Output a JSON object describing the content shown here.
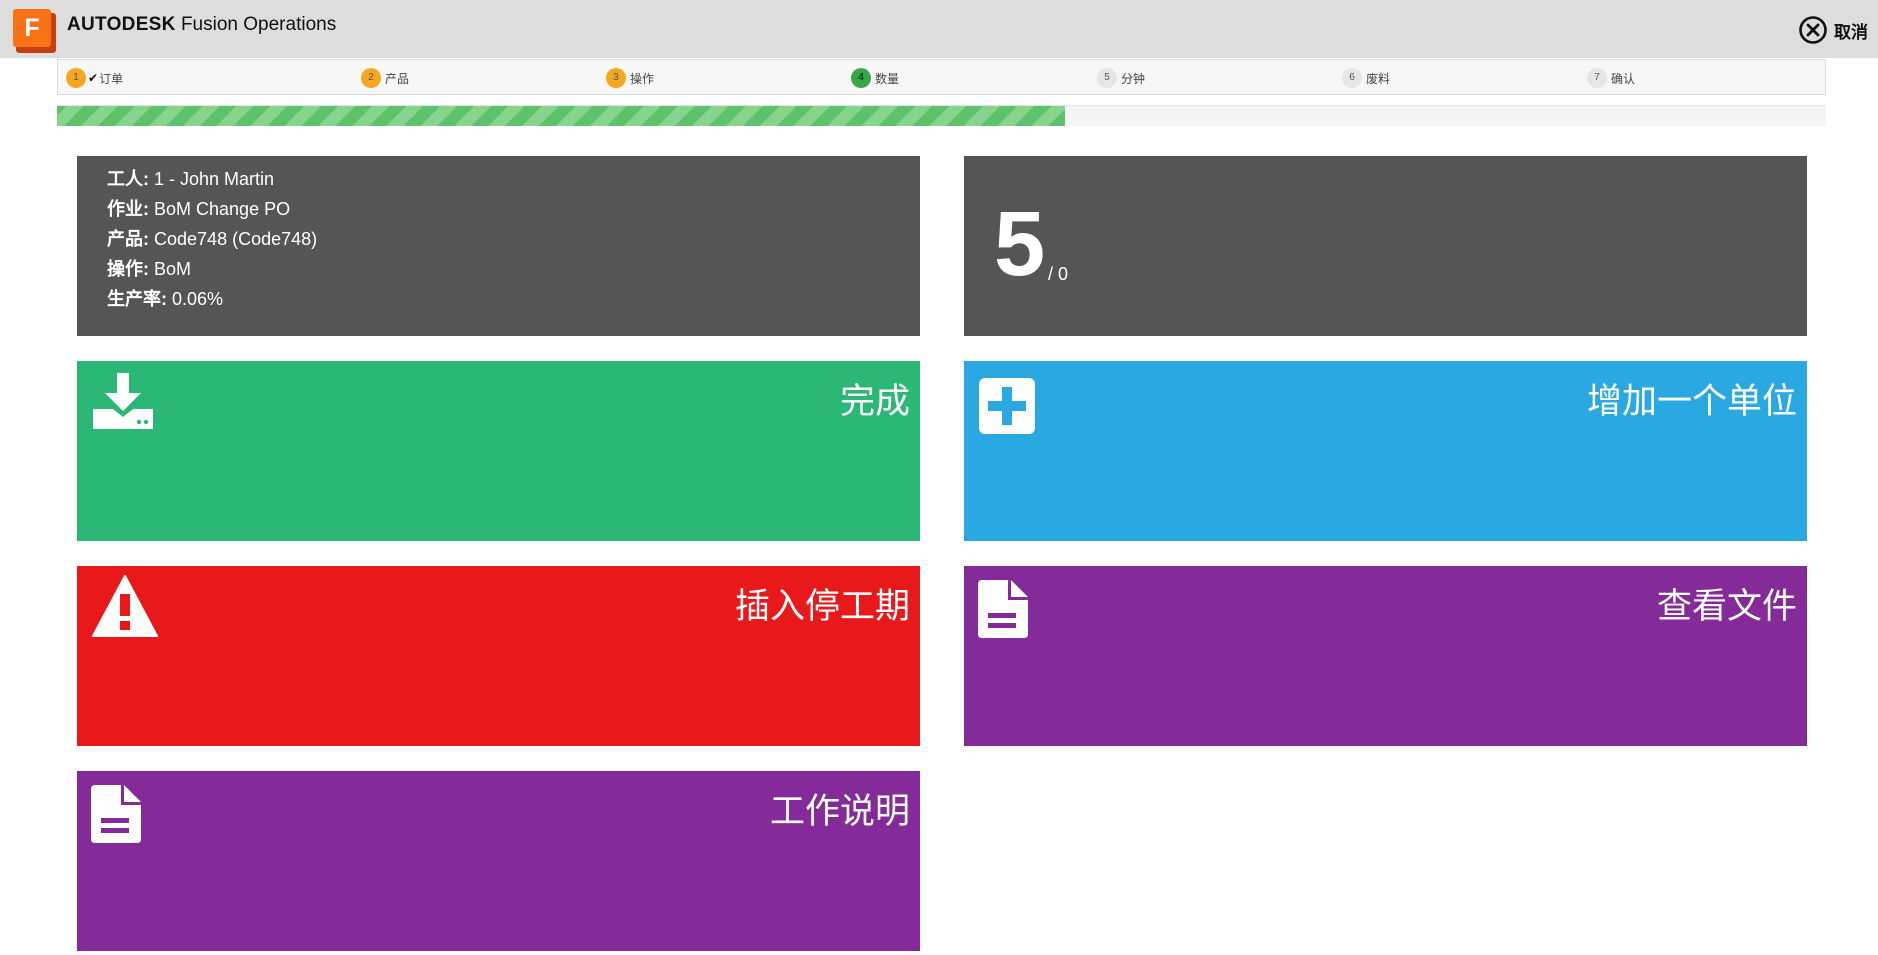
{
  "header": {
    "brand_bold": "AUTODESK",
    "brand_rest": "Fusion Operations",
    "logo_letter": "F",
    "cancel_label": "取消"
  },
  "steps": [
    {
      "num": "1",
      "label": "订单",
      "checked": true,
      "color": "#f5a623"
    },
    {
      "num": "2",
      "label": "产品",
      "color": "#f5a623"
    },
    {
      "num": "3",
      "label": "操作",
      "color": "#f5a623"
    },
    {
      "num": "4",
      "label": "数量",
      "color": "#3aa64a",
      "active": true
    },
    {
      "num": "5",
      "label": "分钟",
      "color": "#e6e6e6"
    },
    {
      "num": "6",
      "label": "废料",
      "color": "#e6e6e6"
    },
    {
      "num": "7",
      "label": "确认",
      "color": "#e6e6e6"
    }
  ],
  "progress": {
    "fraction": 0.57
  },
  "info": {
    "worker_label": "工人:",
    "worker_value": "1 - John Martin",
    "job_label": "作业:",
    "job_value": "BoM Change PO",
    "product_label": "产品:",
    "product_value": "Code748 (Code748)",
    "operation_label": "操作:",
    "operation_value": "BoM",
    "rate_label": "生产率:",
    "rate_value": "0.06%"
  },
  "count": {
    "current": "5",
    "total": "/ 0"
  },
  "tiles": {
    "complete": {
      "title": "完成",
      "icon": "download-tray-icon",
      "color": "#2bb877"
    },
    "add_unit": {
      "title": "增加一个单位",
      "icon": "plus-square-icon",
      "color": "#29a8e1"
    },
    "downtime": {
      "title": "插入停工期",
      "icon": "warning-icon",
      "color": "#e8181b"
    },
    "view_files": {
      "title": "查看文件",
      "icon": "file-icon",
      "color": "#842a99"
    },
    "work_instructions": {
      "title": "工作说明",
      "icon": "file-icon",
      "color": "#842a99"
    }
  }
}
